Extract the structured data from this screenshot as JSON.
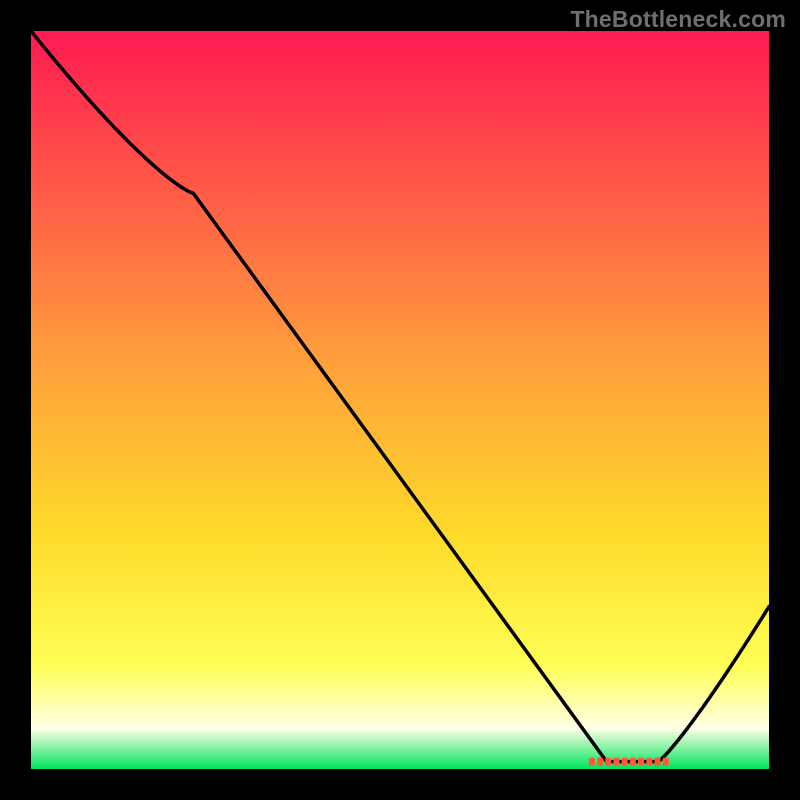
{
  "watermark": "TheBottleneck.com",
  "colors": {
    "gradient_top": "#ff1a52",
    "gradient_upper_mid": "#ffa03c",
    "gradient_mid": "#ffda2a",
    "gradient_lower_mid": "#ffff55",
    "gradient_pale": "#ffffe6",
    "gradient_bottom": "#00e35b",
    "frame": "#000000",
    "line": "#000000",
    "marker": "#ff5a36"
  },
  "chart_data": {
    "type": "line",
    "title": "",
    "xlabel": "",
    "ylabel": "",
    "xlim": [
      0,
      100
    ],
    "ylim": [
      0,
      100
    ],
    "x": [
      0,
      22,
      78,
      85,
      100
    ],
    "values": [
      100,
      78,
      1,
      1,
      22
    ],
    "marker": {
      "x_range": [
        76,
        86
      ],
      "y": 1
    },
    "grid": false,
    "legend": false
  }
}
